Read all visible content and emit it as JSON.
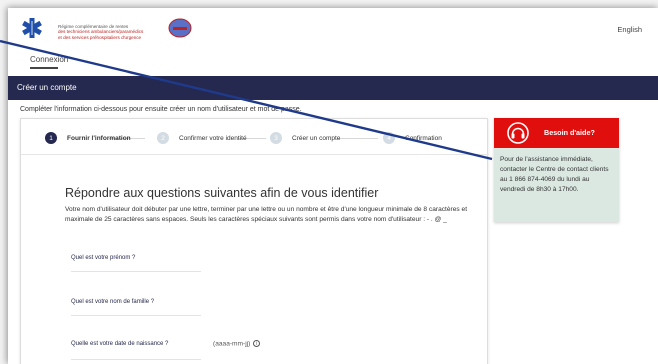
{
  "header": {
    "logo_line1": "Régime complémentaire de rentes",
    "logo_line2": "des techniciens ambulanciers/paramédics",
    "logo_line3": "et des services préhospitaliers d'urgence",
    "language_link": "English",
    "connexion_link": "Connexion"
  },
  "navbar": {
    "title": "Créer un compte"
  },
  "intro": "Compléter l'information ci-dessous pour ensuite créer un nom d'utilisateur et mot de passe.",
  "stepper": [
    {
      "num": "1",
      "label": "Fournir l'information",
      "active": true
    },
    {
      "num": "2",
      "label": "Confirmer votre identité",
      "active": false
    },
    {
      "num": "3",
      "label": "Créer un compte",
      "active": false
    },
    {
      "num": "4",
      "label": "Confirmation",
      "active": false
    }
  ],
  "form": {
    "title": "Répondre aux questions suivantes afin de vous identifier",
    "description": "Votre nom d'utilisateur doit débuter par une lettre, terminer par une lettre ou un nombre et être d'une longueur minimale de 8 caractères et maximale de 25 caractères sans espaces. Seuls les caractères spéciaux suivants sont permis dans votre nom d'utilisateur : - . @ _",
    "first_name_label": "Quel est votre prénom ?",
    "last_name_label": "Quel est votre nom de famille ?",
    "dob_label": "Quelle est votre date de naissance ?",
    "dob_hint": "(aaaa-mm-jj)"
  },
  "help": {
    "title": "Besoin d'aide?",
    "body": "Pour de l'assistance immédiate, contacter le Centre de contact clients au 1 866 874-4069 du lundi au vendredi de 8h30 à 17h00."
  },
  "colors": {
    "navbar": "#25284f",
    "help_header": "#e10e0e",
    "help_body": "#dbe8e2",
    "overlay_line": "#1f3a8a"
  }
}
